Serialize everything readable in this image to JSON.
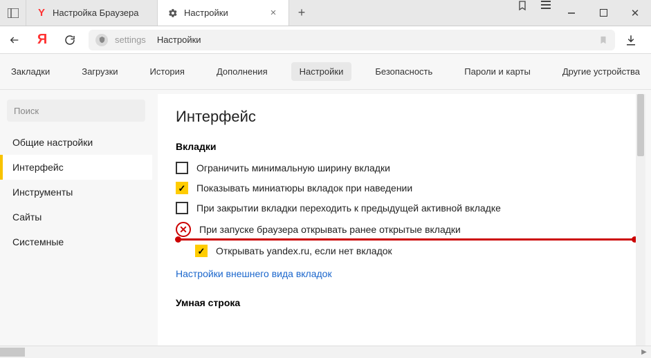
{
  "titlebar": {
    "tabs": [
      {
        "label": "Настройка Браузера",
        "icon": "yandex"
      },
      {
        "label": "Настройки",
        "icon": "gear",
        "active": true
      }
    ]
  },
  "addressbar": {
    "url_host": "settings",
    "url_path": "Настройки"
  },
  "topnav": {
    "items": [
      "Закладки",
      "Загрузки",
      "История",
      "Дополнения",
      "Настройки",
      "Безопасность",
      "Пароли и карты",
      "Другие устройства"
    ],
    "active_index": 4
  },
  "sidebar": {
    "search_placeholder": "Поиск",
    "items": [
      "Общие настройки",
      "Интерфейс",
      "Инструменты",
      "Сайты",
      "Системные"
    ],
    "active_index": 1
  },
  "main": {
    "heading": "Интерфейс",
    "section_tabs_title": "Вкладки",
    "checkboxes": [
      {
        "label": "Ограничить минимальную ширину вкладки",
        "checked": false
      },
      {
        "label": "Показывать миниатюры вкладок при наведении",
        "checked": true
      },
      {
        "label": "При закрытии вкладки переходить к предыдущей активной вкладке",
        "checked": false
      },
      {
        "label": "При запуске браузера открывать ранее открытые вкладки",
        "checked": false,
        "annotation": "crossed"
      },
      {
        "label": "Открывать yandex.ru, если нет вкладок",
        "checked": true,
        "indent": true
      }
    ],
    "link_tab_appearance": "Настройки внешнего вида вкладок",
    "section_smartline_title": "Умная строка"
  }
}
